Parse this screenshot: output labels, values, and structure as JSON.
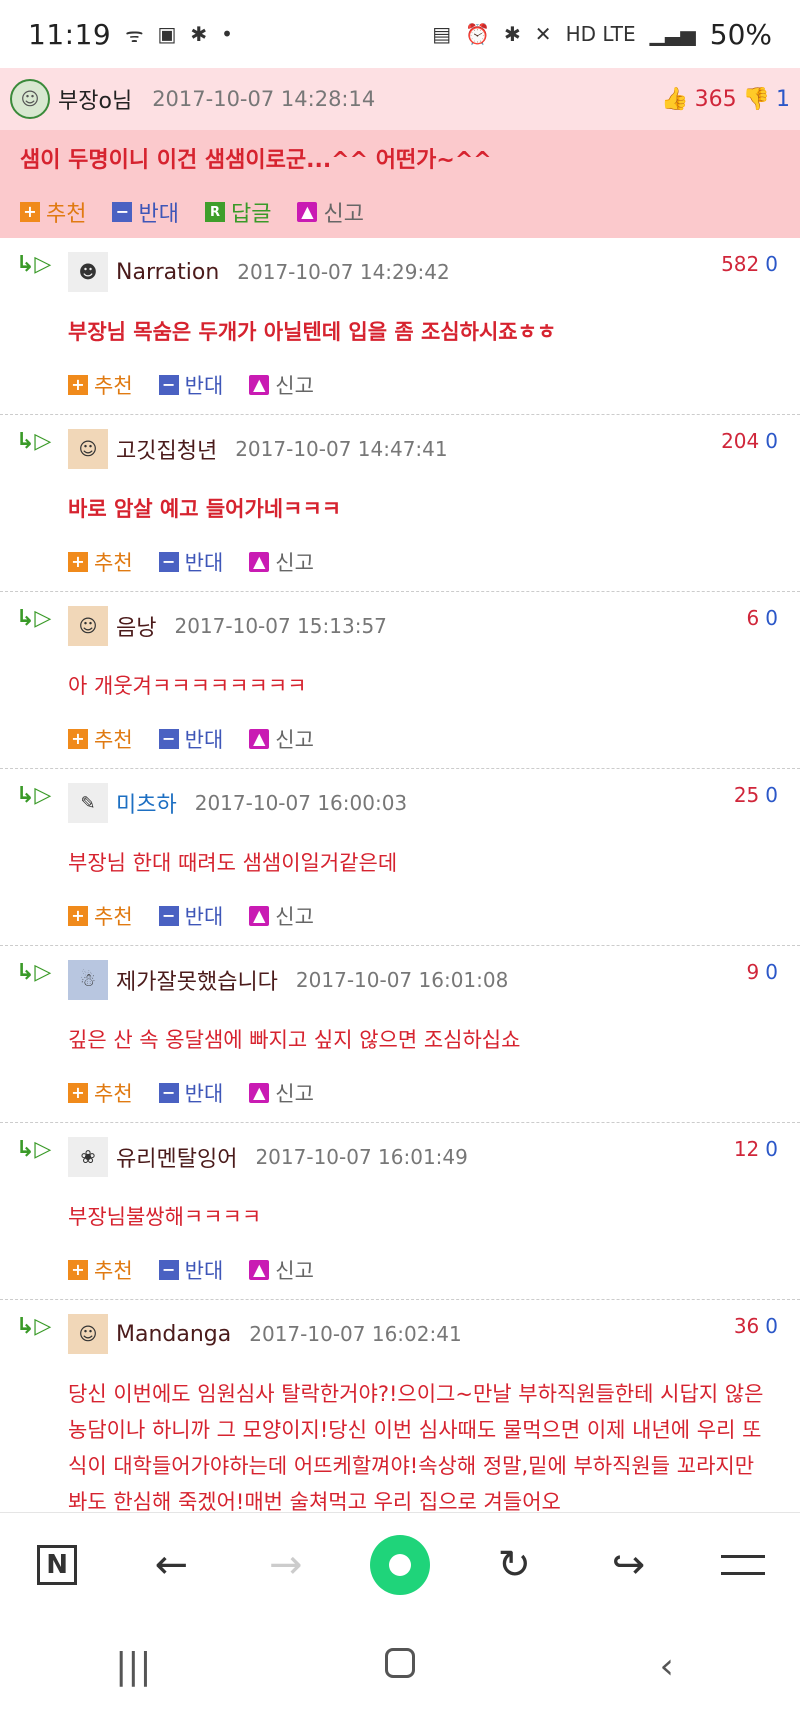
{
  "status_bar": {
    "time": "11:19",
    "left_icons": [
      "ᯤ",
      "▣",
      "✱",
      "•"
    ],
    "network": "HD LTE",
    "battery": "50%"
  },
  "post": {
    "author": "부장o님",
    "date": "2017-10-07 14:28:14",
    "up": "365",
    "down": "1",
    "text": "샘이 두명이니 이건 샘샘이로군...^^ 어떤가~^^",
    "actions": {
      "recommend": "추천",
      "oppose": "반대",
      "reply": "답글",
      "report": "신고"
    }
  },
  "comment_actions": {
    "recommend": "추천",
    "oppose": "반대",
    "report": "신고"
  },
  "comments": [
    {
      "author": "Narration",
      "date": "2017-10-07 14:29:42",
      "up": "582",
      "down": "0",
      "text": "부장님 목숨은 두개가 아닐텐데 입을 좀 조심하시죠ㅎㅎ"
    },
    {
      "author": "고깃집청년",
      "date": "2017-10-07 14:47:41",
      "up": "204",
      "down": "0",
      "text": "바로 암살 예고 들어가네ㅋㅋㅋ"
    },
    {
      "author": "음낭",
      "date": "2017-10-07 15:13:57",
      "up": "6",
      "down": "0",
      "text": "아 개웃겨ㅋㅋㅋㅋㅋㅋㅋㅋ"
    },
    {
      "author": "미츠하",
      "date": "2017-10-07 16:00:03",
      "up": "25",
      "down": "0",
      "text": "부장님 한대 때려도 샘샘이일거같은데"
    },
    {
      "author": "제가잘못했습니다",
      "date": "2017-10-07 16:01:08",
      "up": "9",
      "down": "0",
      "text": "깊은 산 속 옹달샘에 빠지고 싶지 않으면 조심하십쇼"
    },
    {
      "author": "유리멘탈잉어",
      "date": "2017-10-07 16:01:49",
      "up": "12",
      "down": "0",
      "text": "부장님불쌍해ㅋㅋㅋㅋ"
    },
    {
      "author": "Mandanga",
      "date": "2017-10-07 16:02:41",
      "up": "36",
      "down": "0",
      "text": "당신 이번에도 임원심사 탈락한거야?!으이그~만날 부하직원들한테 시답지 않은 농담이나 하니까 그 모양이지!당신 이번 심사때도 물먹으면 이제 내년에 우리 또식이 대학들어가야하는데 어뜨케할껴야!속상해 정말,밑에 부하직원들 꼬라지만 봐도 한심해 죽겠어!매번 술쳐먹고 우리 집으로 겨들어오"
    }
  ],
  "browser_bar": {
    "n_label": "N"
  }
}
